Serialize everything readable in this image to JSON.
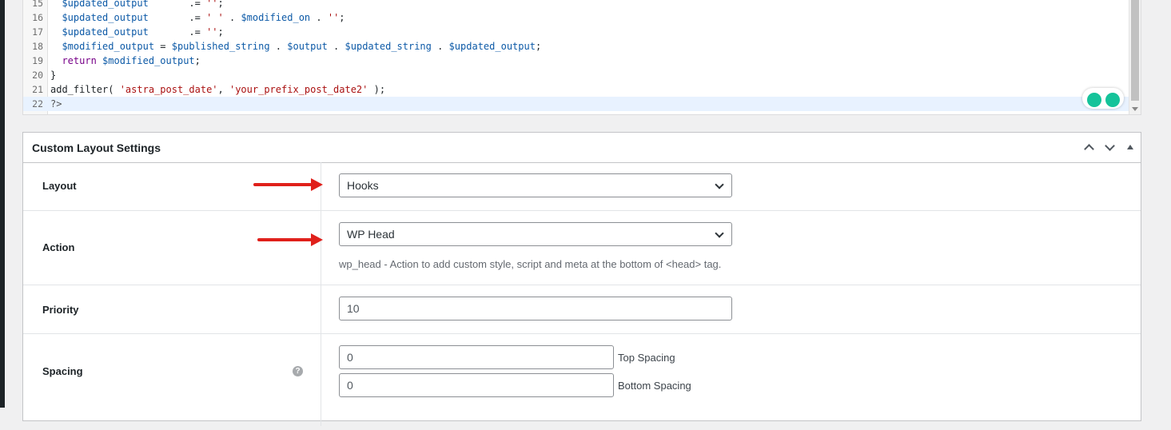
{
  "editor": {
    "lines": [
      {
        "num": "15",
        "tokens": [
          {
            "t": "  ",
            "c": "op"
          },
          {
            "t": "$updated_output",
            "c": "var"
          },
          {
            "t": "       .= ",
            "c": "op"
          },
          {
            "t": "''",
            "c": "str"
          },
          {
            "t": ";",
            "c": "op"
          }
        ]
      },
      {
        "num": "16",
        "tokens": [
          {
            "t": "  ",
            "c": "op"
          },
          {
            "t": "$updated_output",
            "c": "var"
          },
          {
            "t": "       .= ",
            "c": "op"
          },
          {
            "t": "' '",
            "c": "str"
          },
          {
            "t": " . ",
            "c": "op"
          },
          {
            "t": "$modified_on",
            "c": "var"
          },
          {
            "t": " . ",
            "c": "op"
          },
          {
            "t": "''",
            "c": "str"
          },
          {
            "t": ";",
            "c": "op"
          }
        ]
      },
      {
        "num": "17",
        "tokens": [
          {
            "t": "  ",
            "c": "op"
          },
          {
            "t": "$updated_output",
            "c": "var"
          },
          {
            "t": "       .= ",
            "c": "op"
          },
          {
            "t": "''",
            "c": "str"
          },
          {
            "t": ";",
            "c": "op"
          }
        ]
      },
      {
        "num": "18",
        "tokens": [
          {
            "t": "  ",
            "c": "op"
          },
          {
            "t": "$modified_output",
            "c": "var"
          },
          {
            "t": " = ",
            "c": "op"
          },
          {
            "t": "$published_string",
            "c": "var"
          },
          {
            "t": " . ",
            "c": "op"
          },
          {
            "t": "$output",
            "c": "var"
          },
          {
            "t": " . ",
            "c": "op"
          },
          {
            "t": "$updated_string",
            "c": "var"
          },
          {
            "t": " . ",
            "c": "op"
          },
          {
            "t": "$updated_output",
            "c": "var"
          },
          {
            "t": ";",
            "c": "op"
          }
        ]
      },
      {
        "num": "19",
        "tokens": [
          {
            "t": "  ",
            "c": "op"
          },
          {
            "t": "return",
            "c": "kw"
          },
          {
            "t": " ",
            "c": "op"
          },
          {
            "t": "$modified_output",
            "c": "var"
          },
          {
            "t": ";",
            "c": "op"
          }
        ]
      },
      {
        "num": "20",
        "tokens": [
          {
            "t": "}",
            "c": "op"
          }
        ]
      },
      {
        "num": "21",
        "tokens": [
          {
            "t": "add_filter( ",
            "c": "op"
          },
          {
            "t": "'astra_post_date'",
            "c": "str"
          },
          {
            "t": ", ",
            "c": "op"
          },
          {
            "t": "'your_prefix_post_date2'",
            "c": "str"
          },
          {
            "t": " );",
            "c": "op"
          }
        ]
      },
      {
        "num": "22",
        "tokens": [
          {
            "t": "?>",
            "c": "php"
          }
        ]
      }
    ]
  },
  "metabox": {
    "title": "Custom Layout Settings"
  },
  "rows": {
    "layout": {
      "label": "Layout",
      "value": "Hooks"
    },
    "action": {
      "label": "Action",
      "value": "WP Head",
      "description": "wp_head - Action to add custom style, script and meta at the bottom of <head> tag."
    },
    "priority": {
      "label": "Priority",
      "value": "10"
    },
    "spacing": {
      "label": "Spacing",
      "top_value": "0",
      "top_label": "Top Spacing",
      "bottom_value": "0",
      "bottom_label": "Bottom Spacing",
      "help_icon": "question-icon"
    }
  },
  "colors": {
    "arrow": "#e0201b",
    "grammarly": "#15c39a"
  }
}
